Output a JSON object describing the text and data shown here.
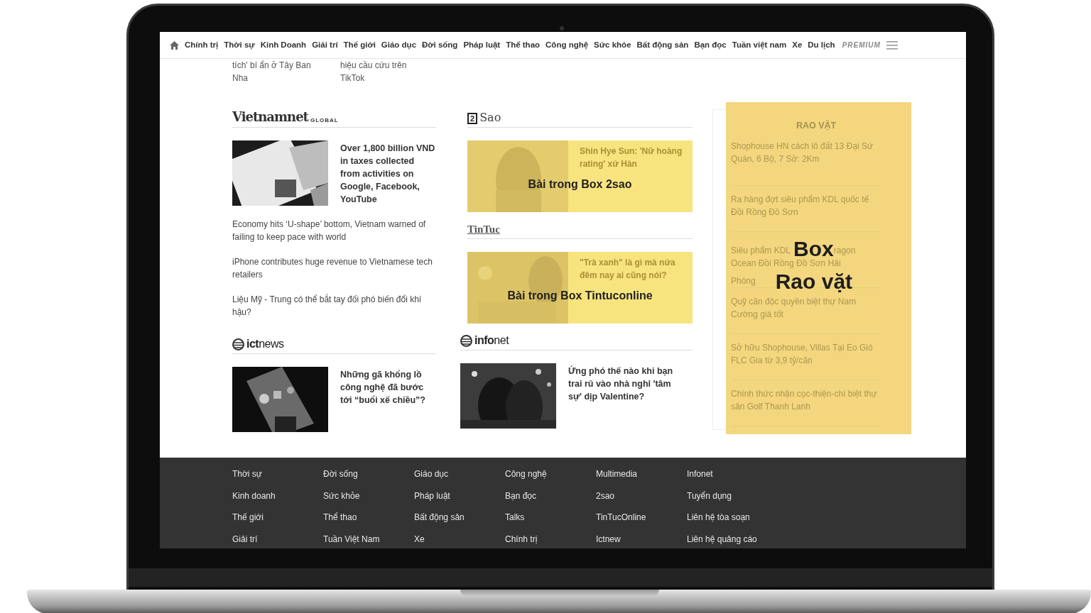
{
  "nav": {
    "items": [
      "Chính trị",
      "Thời sự",
      "Kinh Doanh",
      "Giải trí",
      "Thế giới",
      "Giáo dục",
      "Đời sống",
      "Pháp luật",
      "Thể thao",
      "Công nghệ",
      "Sức khỏe",
      "Bất động sản",
      "Bạn đọc",
      "Tuần việt nam",
      "Xe",
      "Du lịch"
    ],
    "premium": "PREMIUM"
  },
  "snippets": [
    "tích' bí ẩn ở Tây Ban Nha",
    "hiệu cầu cứu trên TikTok"
  ],
  "columns": [
    [
      {
        "kind": "plain",
        "logo": {
          "kind": "serif",
          "text": "Vietnamnet",
          "sub": "GLOBAL"
        },
        "lead": {
          "title": "Over 1,800 billion VND in taxes collected from activities on Google, Facebook, YouTube"
        },
        "links": [
          "Economy hits ‘U-shape’ bottom, Vietnam warned of failing to keep pace with world",
          "iPhone contributes huge revenue to Vietnamese tech retailers",
          "Liệu Mỹ - Trung có thể bắt tay đối phó biến đổi khí hậu?"
        ]
      },
      {
        "kind": "plain",
        "logo": {
          "kind": "globe",
          "text": "ict",
          "tail": "news"
        },
        "lead": {
          "title": "Những gã khổng lồ công nghệ đã bước tới “buổi xế chiều”?"
        }
      }
    ],
    [
      {
        "kind": "box",
        "logo": {
          "kind": "boxed",
          "mark": "2",
          "text": "Sao"
        },
        "lead": {
          "title": "Shin Hye Sun: 'Nữ hoàng rating' xứ Hàn"
        },
        "overlay_label": "Bài trong Box 2sao"
      },
      {
        "kind": "box",
        "logo": {
          "kind": "underlined",
          "text": "TinTuc"
        },
        "lead": {
          "title": "\"Trà xanh\" là gì mà nửa đêm nay ai cũng nói?"
        },
        "overlay_label": "Bài trong Box Tintuconline"
      },
      {
        "kind": "plain",
        "logo": {
          "kind": "globe",
          "text": "info",
          "tail": "net"
        },
        "lead": {
          "title": "Ứng phó thế nào khi bạn trai rủ vào nhà nghỉ 'tâm sự' dịp Valentine?"
        }
      }
    ]
  ],
  "rao_vat": {
    "title": "RAO VẶT",
    "items": [
      {
        "kind": "link",
        "text": "Shophouse HN cách lô đất 13 Đại Sứ Quán, 6 Bộ, 7 Sở: 2Km"
      },
      {
        "kind": "link",
        "text": "Ra hàng đợt siêu phẩm KDL quốc tế Đồi Rồng Đồ Sơn"
      },
      {
        "kind": "covered",
        "parts": [
          "Siêu phẩm KDL",
          "ragon",
          "Ocean Đồi Rồng Đồ Sơn Hải",
          "Phòng"
        ],
        "overlay_lines": [
          "Box",
          "Rao vặt"
        ]
      },
      {
        "kind": "link",
        "text": "Quỹ căn độc quyền biệt thự Nam Cường giá tốt"
      },
      {
        "kind": "link",
        "text": "Sở hữu Shophouse, Villas Tại Eo Gió FLC Gia từ 3,9 tỷ/căn"
      },
      {
        "kind": "link",
        "text": "Chính thức nhận cọc-thiện-chí biệt thự sân Golf Thanh Lanh"
      }
    ]
  },
  "footer": {
    "columns": [
      [
        "Thời sự",
        "Kinh doanh",
        "Thế giới",
        "Giải trí"
      ],
      [
        "Đời sống",
        "Sức khỏe",
        "Thể thao",
        "Tuần Việt Nam"
      ],
      [
        "Giáo dục",
        "Pháp luật",
        "Bất động sản",
        "Xe"
      ],
      [
        "Công nghệ",
        "Bạn đọc",
        "Talks",
        "Chính trị"
      ],
      [
        "Multimedia",
        "2sao",
        "TinTucOnline",
        "Ictnew"
      ],
      [
        "Infonet",
        "Tuyển dụng",
        "Liên hệ tòa soạn",
        "Liên hệ quảng cáo"
      ]
    ]
  }
}
